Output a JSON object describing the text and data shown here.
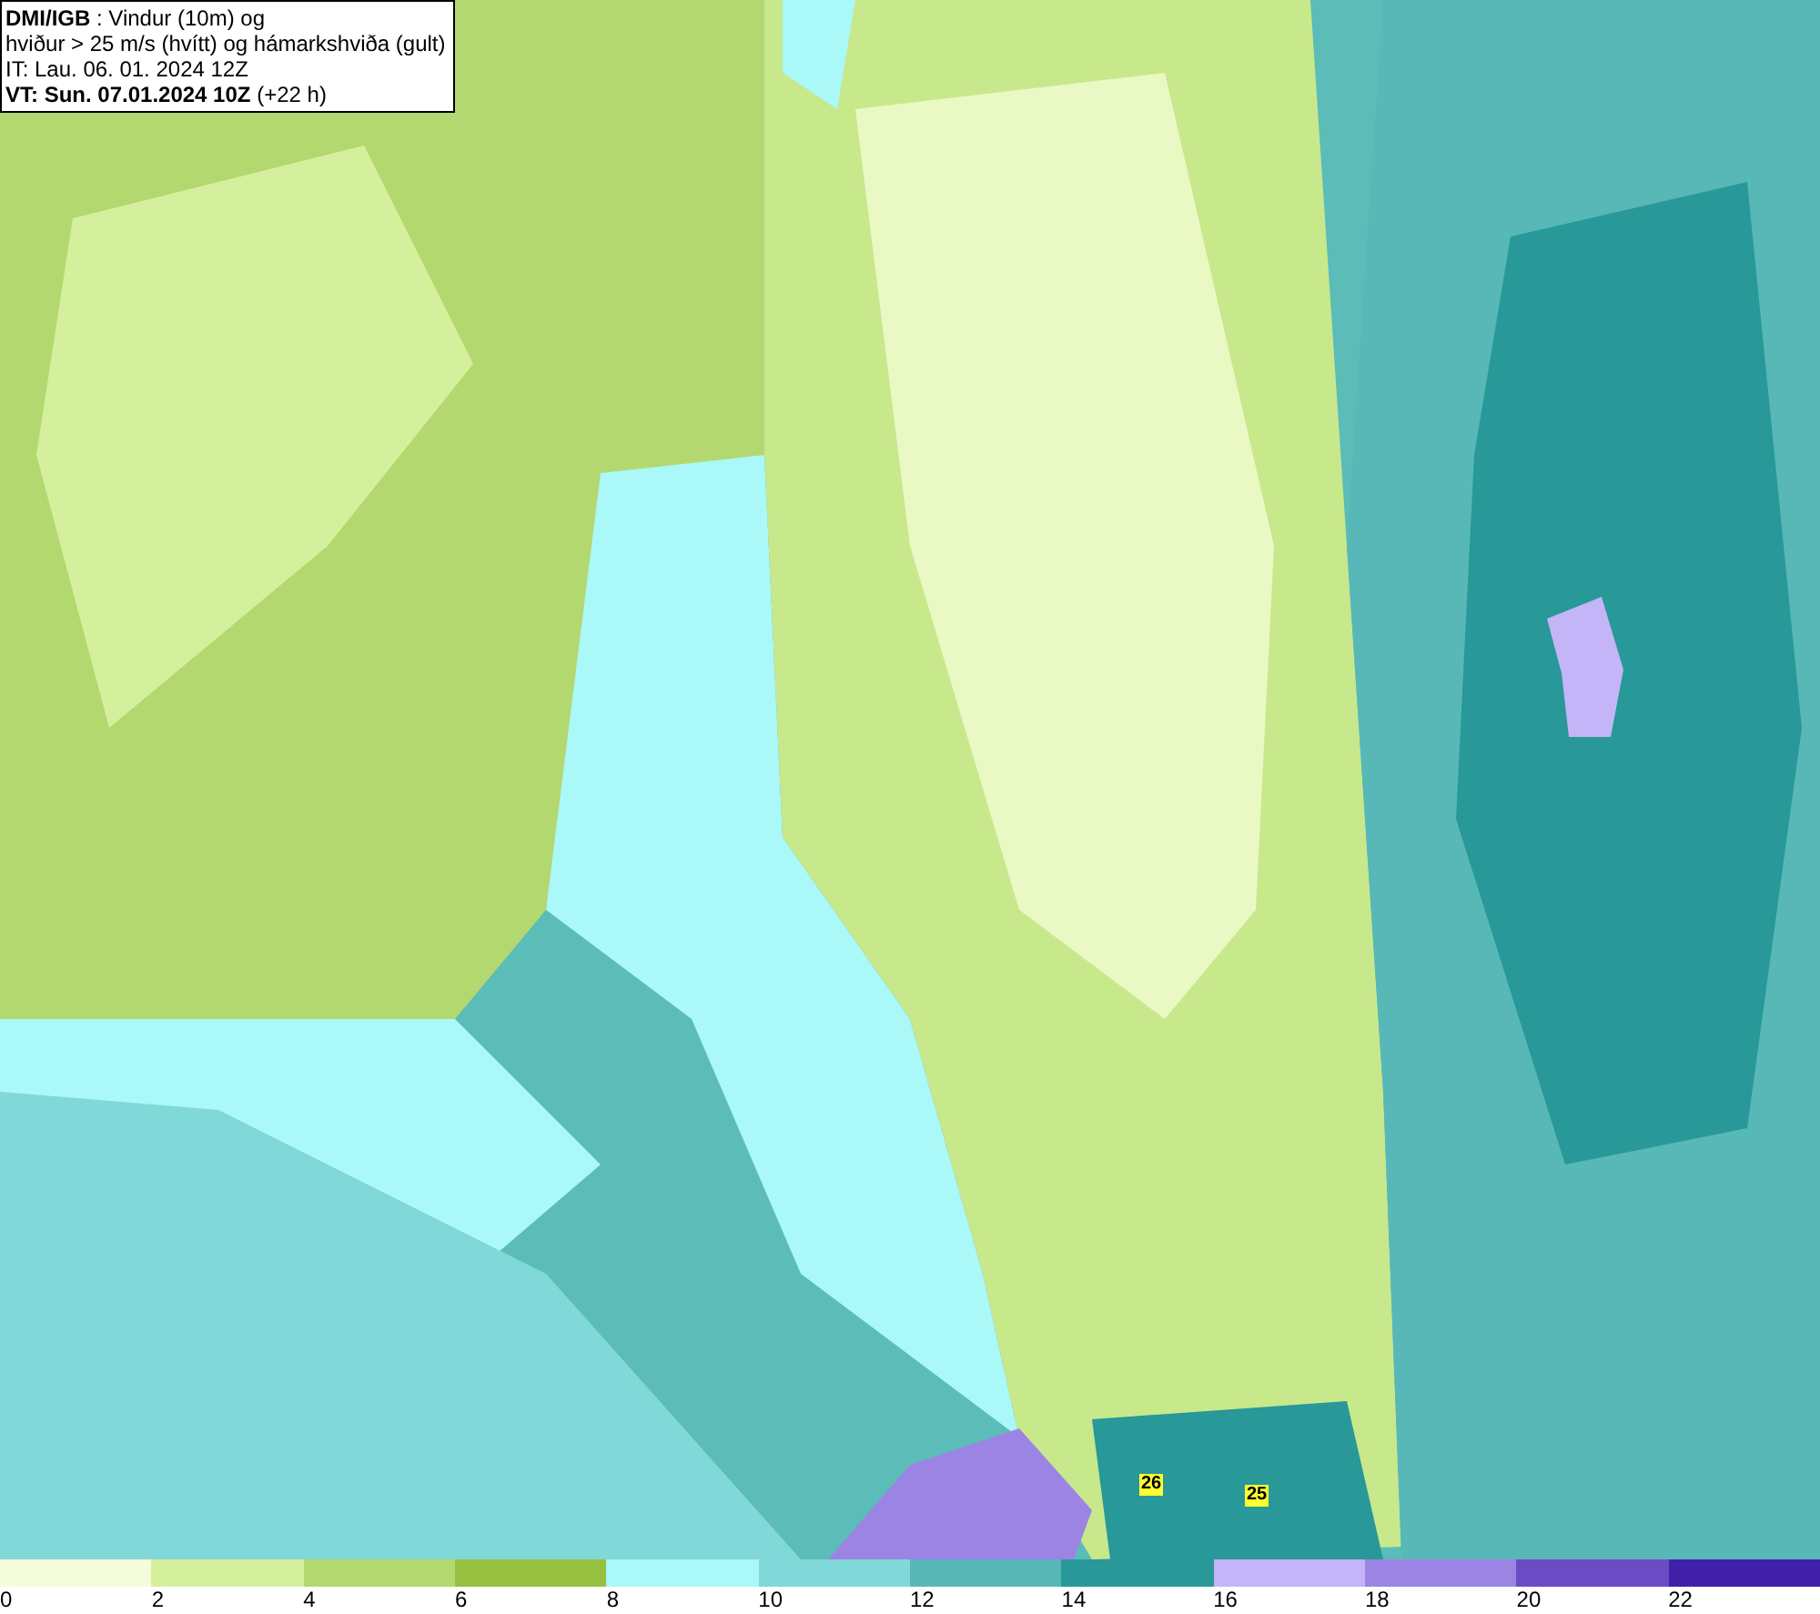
{
  "info_box": {
    "lines": [
      "**DMI/IGB** : Vindur (10m) og",
      "hviður > 25 m/s (hvítt) og hámarkshviða (gult)",
      "IT: Lau. 06. 01. 2024 12Z",
      "**VT: Sun. 07.01.2024 10Z** (+22 h)"
    ]
  },
  "gust_labels": [
    "26",
    "25"
  ],
  "legend": [
    {
      "label": "0",
      "color": "#f4fcdc"
    },
    {
      "label": "2",
      "color": "#d4f09c"
    },
    {
      "label": "4",
      "color": "#b4d870"
    },
    {
      "label": "6",
      "color": "#98c040"
    },
    {
      "label": "8",
      "color": "#aaf8f8"
    },
    {
      "label": "10",
      "color": "#80d8d8"
    },
    {
      "label": "12",
      "color": "#58b8b8"
    },
    {
      "label": "14",
      "color": "#289898"
    },
    {
      "label": "16",
      "color": "#c4b4f8"
    },
    {
      "label": "18",
      "color": "#9c84e4"
    },
    {
      "label": "20",
      "color": "#6c4cc4"
    },
    {
      "label": "22",
      "color": "#4020a8"
    }
  ]
}
